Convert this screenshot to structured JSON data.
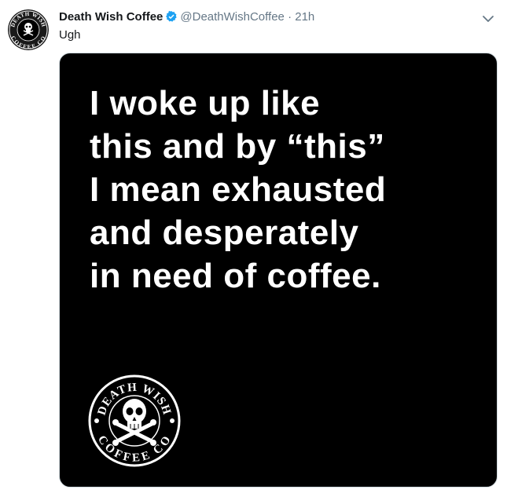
{
  "tweet": {
    "author_name": "Death Wish Coffee",
    "handle": "@DeathWishCoffee",
    "separator": "·",
    "time": "21h",
    "text": "Ugh"
  },
  "avatar": {
    "top_text": "DEATH WISH",
    "bottom_text": "COFFEE CO"
  },
  "media": {
    "lines": [
      "I woke up like",
      "this and by “this”",
      "I mean exhausted",
      "and desperately",
      "in need of coffee."
    ],
    "logo_top_text": "DEATH WISH",
    "logo_bottom_text": "COFFEE CO"
  },
  "colors": {
    "verified": "#1da1f2",
    "secondary_text": "#657786",
    "image_background": "#000000"
  },
  "icons": [
    "verified-badge-icon",
    "chevron-down-icon",
    "skull-crossbones-icon"
  ]
}
